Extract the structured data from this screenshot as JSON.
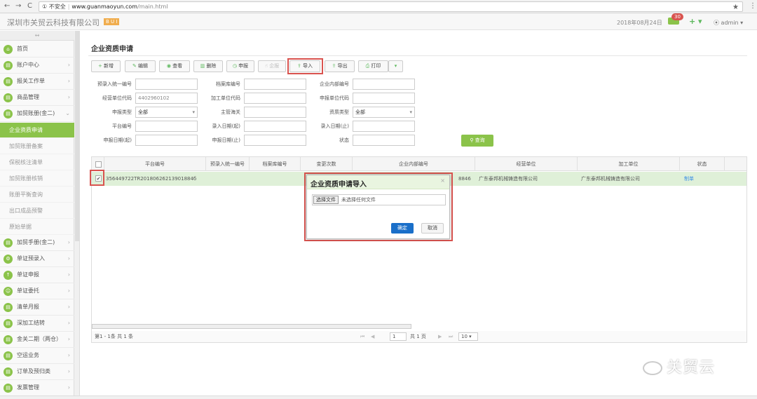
{
  "browser": {
    "back": "←",
    "forward": "→",
    "reload": "C",
    "security": "① 不安全",
    "url_domain": "www.guanmaoyun.com",
    "url_path": "/main.html"
  },
  "topbar": {
    "company": "深圳市关贸云科技有限公司",
    "version": "B U I",
    "date": "2018年08月24日",
    "msg_count": "30",
    "plus": "+ ▾",
    "user": "⦿ admin ▾"
  },
  "sidebar": {
    "collapse": "↔",
    "items": [
      {
        "label": "首页",
        "arrow": ""
      },
      {
        "label": "账户中心",
        "arrow": "›"
      },
      {
        "label": "报关工作单",
        "arrow": "›"
      },
      {
        "label": "商品管理",
        "arrow": "›"
      },
      {
        "label": "加贸账册(金二)",
        "arrow": "⌄"
      }
    ],
    "subitems": [
      "企业资质申请",
      "加贸账册备案",
      "保税核注清单",
      "加贸账册核销",
      "账册平衡查询",
      "出口成品预警",
      "原始单据"
    ],
    "items2": [
      {
        "label": "加贸手册(金二)",
        "arrow": "›"
      },
      {
        "label": "单证预录入",
        "arrow": "›"
      },
      {
        "label": "单证申报",
        "arrow": "›"
      },
      {
        "label": "单证委托",
        "arrow": "›"
      },
      {
        "label": "清单月报",
        "arrow": "›"
      },
      {
        "label": "深加工结转",
        "arrow": "›"
      },
      {
        "label": "金关二期（两仓）",
        "arrow": "›"
      },
      {
        "label": "空运业务",
        "arrow": "›"
      },
      {
        "label": "订单及预归类",
        "arrow": "›"
      },
      {
        "label": "发票管理",
        "arrow": "›"
      }
    ]
  },
  "page": {
    "title": "企业资质申请"
  },
  "toolbar": {
    "add": "新增",
    "edit": "编辑",
    "view": "查看",
    "delete": "删除",
    "declare": "申报",
    "approve": "企报",
    "import": "导入",
    "export": "导出",
    "print": "打印",
    "more": "▾"
  },
  "form": {
    "l1": "预录入统一编号",
    "l2": "档案库编号",
    "l3": "企业内部编号",
    "l4": "经营单位代码",
    "v4": "4402960102",
    "l5": "加工单位代码",
    "l6": "申报单位代码",
    "l7": "申报类型",
    "v7": "全部",
    "l8": "主管海关",
    "l9": "资质类型",
    "v9": "全部",
    "l10": "平台编号",
    "l11": "录入日期(起)",
    "l12": "录入日期(止)",
    "l13": "申报日期(起)",
    "l14": "申报日期(止)",
    "l15": "状态",
    "query": "查询"
  },
  "grid": {
    "headers": [
      "平台编号",
      "预录入统一编号",
      "档案库编号",
      "变更次数",
      "企业内部编号",
      "经营单位",
      "加工单位",
      "状态"
    ],
    "row": {
      "platform": "356449722TR20180626213901884б",
      "internal_tail": "8846",
      "company": "广东泰邦机械铸造有限公司",
      "process": "广东泰邦机械铸造有限公司",
      "status": "制单"
    }
  },
  "pager": {
    "info": "第1 - 1条  共 1 条",
    "page": "1",
    "total": "共 1 页",
    "size": "10 ▾"
  },
  "dialog": {
    "title": "企业资质申请导入",
    "close": "×",
    "file_button": "选择文件",
    "file_text": "未选择任何文件",
    "ok": "确定",
    "cancel": "取消"
  },
  "watermark": "关贸云"
}
